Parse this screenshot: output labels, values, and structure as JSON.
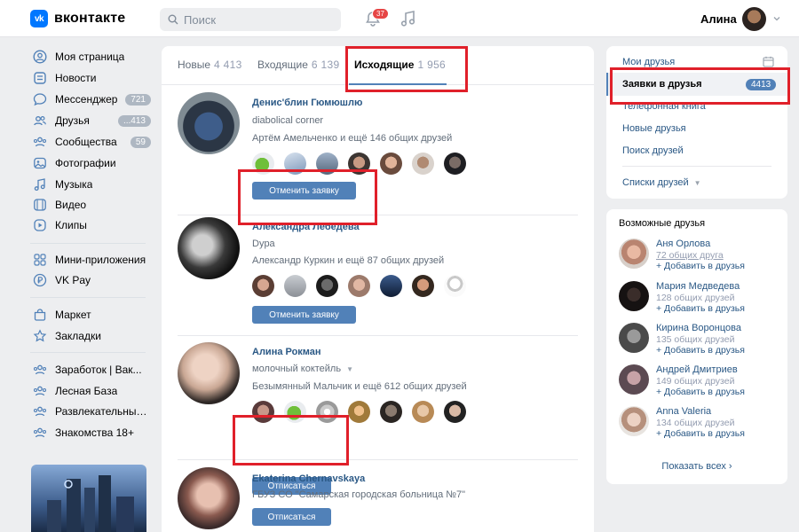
{
  "header": {
    "logo_mark": "vk",
    "logo_text": "вконтакте",
    "search_placeholder": "Поиск",
    "notifications_count": "37",
    "user_name": "Алина"
  },
  "nav": {
    "items": [
      {
        "label": "Моя страница",
        "icon": "user-circle-icon"
      },
      {
        "label": "Новости",
        "icon": "news-icon"
      },
      {
        "label": "Мессенджер",
        "icon": "message-icon",
        "badge": "721"
      },
      {
        "label": "Друзья",
        "icon": "friends-icon",
        "badge": "...413"
      },
      {
        "label": "Сообщества",
        "icon": "communities-icon",
        "badge": "59"
      },
      {
        "label": "Фотографии",
        "icon": "photo-icon"
      },
      {
        "label": "Музыка",
        "icon": "music-icon"
      },
      {
        "label": "Видео",
        "icon": "video-icon"
      },
      {
        "label": "Клипы",
        "icon": "clips-icon"
      },
      {
        "label": "Мини-приложения",
        "icon": "apps-icon"
      },
      {
        "label": "VK Pay",
        "icon": "vkpay-icon"
      },
      {
        "label": "Маркет",
        "icon": "market-icon"
      },
      {
        "label": "Закладки",
        "icon": "bookmark-icon"
      },
      {
        "label": "Заработок | Вак...",
        "icon": "group-icon"
      },
      {
        "label": "Лесная База",
        "icon": "group-icon"
      },
      {
        "label": "Развлекательный...",
        "icon": "group-icon"
      },
      {
        "label": "Знакомства 18+",
        "icon": "group-icon"
      }
    ]
  },
  "tabs": [
    {
      "label": "Новые",
      "count": "4 413"
    },
    {
      "label": "Входящие",
      "count": "6 139"
    },
    {
      "label": "Исходящие",
      "count": "1 956",
      "active": true
    }
  ],
  "requests": [
    {
      "name": "Денис'блин Гюмюшлю",
      "sub": "diabolical corner",
      "mutual": "Артём Амельченко и ещё 146 общих друзей",
      "button": "Отменить заявку"
    },
    {
      "name": "Александра Лебедева",
      "sub": "Dypa",
      "mutual": "Александр Куркин и ещё 87 общих друзей",
      "button": "Отменить заявку"
    },
    {
      "name": "Алина Рокман",
      "sub": "молочный коктейль",
      "mutual": "Безымянный Мальчик и ещё 612 общих друзей",
      "button": "Отписаться"
    },
    {
      "name": "Ekaterina Chernavskaya",
      "sub": "ГБУЗ СО \"Самарская городская больница №7\"",
      "mutual": "",
      "button": "Отписаться"
    }
  ],
  "side_menu": {
    "my_friends": "Мои друзья",
    "requests_label": "Заявки в друзья",
    "requests_badge": "4413",
    "phone_book": "Телефонная книга",
    "new_friends": "Новые друзья",
    "search_friends": "Поиск друзей",
    "friend_lists": "Списки друзей"
  },
  "possible_friends": {
    "title": "Возможные друзья",
    "items": [
      {
        "name": "Аня Орлова",
        "common": "72 общих друга",
        "add": "+ Добавить в друзья"
      },
      {
        "name": "Мария Медведева",
        "common": "128 общих друзей",
        "add": "+ Добавить в друзья"
      },
      {
        "name": "Кирина Воронцова",
        "common": "135 общих друзей",
        "add": "+ Добавить в друзья"
      },
      {
        "name": "Андрей Дмитриев",
        "common": "149 общих друзей",
        "add": "+ Добавить в друзья"
      },
      {
        "name": "Anna Valeria",
        "common": "134 общих друзей",
        "add": "+ Добавить в друзья"
      }
    ],
    "show_all": "Показать всех"
  },
  "colors": {
    "accent": "#5181b8",
    "link": "#2a5885",
    "background": "#edeef0",
    "annotation_red": "#e0202a"
  }
}
